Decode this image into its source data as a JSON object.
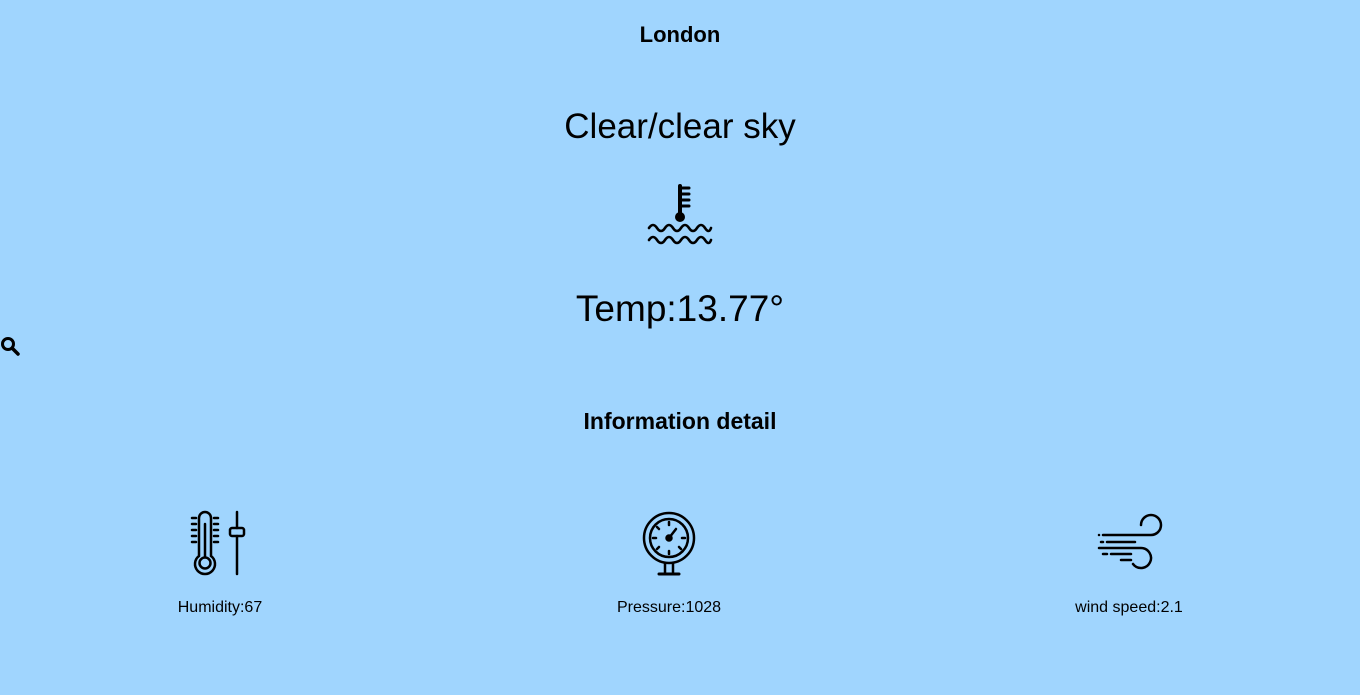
{
  "city": "London",
  "condition": "Clear/clear sky",
  "temperature": "Temp:13.77°",
  "section_title": "Information detail",
  "details": {
    "humidity": "Humidity:67",
    "pressure": "Pressure:1028",
    "wind": "wind speed:2.1"
  },
  "icons": {
    "main": "temperature-water-icon",
    "search": "search-icon",
    "humidity": "thermometer-slider-icon",
    "pressure": "pressure-gauge-icon",
    "wind": "wind-icon"
  },
  "colors": {
    "background": "#a0d5fe",
    "foreground": "#000000"
  }
}
